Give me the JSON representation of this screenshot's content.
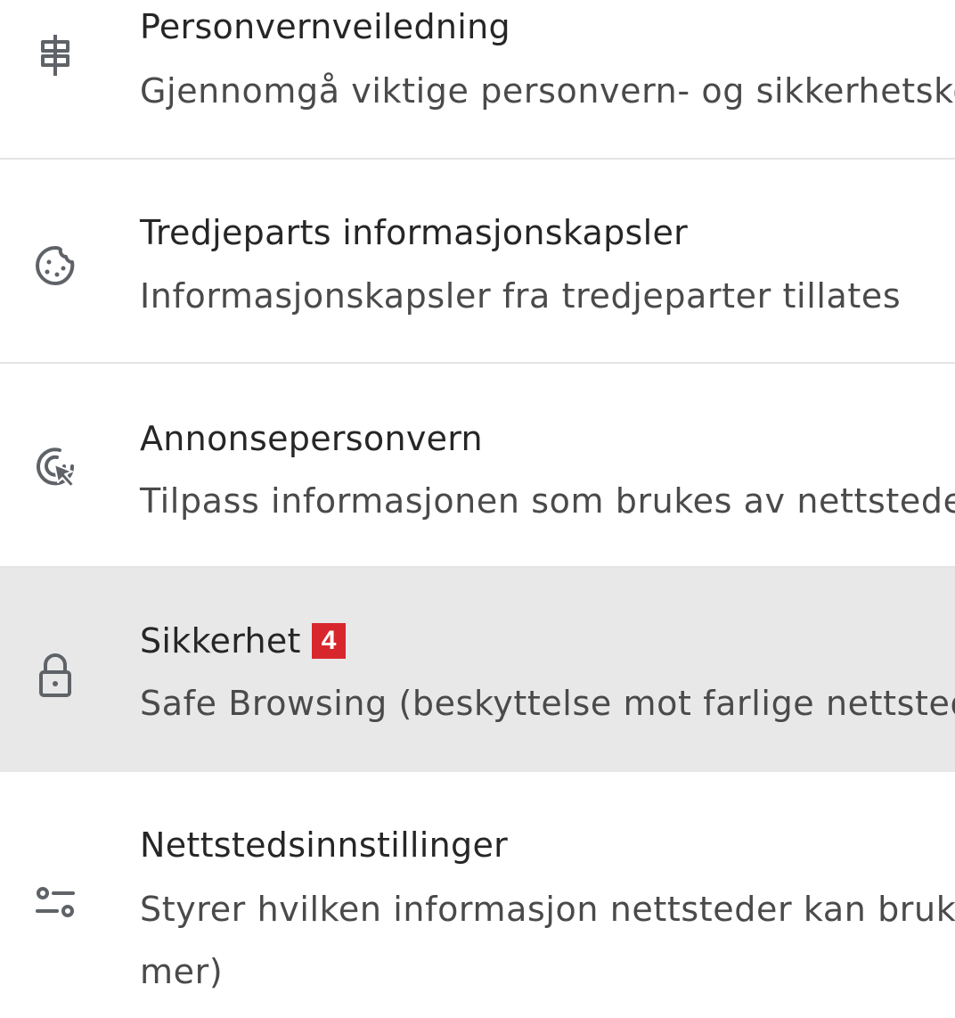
{
  "items": [
    {
      "title": "Personvernveiledning",
      "subtitle": "Gjennomgå viktige personvern- og sikkerhetskontroller",
      "icon": "signpost-icon"
    },
    {
      "title": "Tredjeparts informasjonskapsler",
      "subtitle": "Informasjonskapsler fra tredjeparter tillates",
      "icon": "cookie-icon"
    },
    {
      "title": "Annonsepersonvern",
      "subtitle": "Tilpass informasjonen som brukes av nettsteder",
      "icon": "ad-target-cursor-icon"
    },
    {
      "title": "Sikkerhet",
      "badge": "4",
      "subtitle": "Safe Browsing (beskyttelse mot farlige nettsteder)",
      "icon": "lock-icon",
      "active": true
    },
    {
      "title": "Nettstedsinnstillinger",
      "subtitle": "Styrer hvilken informasjon nettsteder kan bruke og vise (posisjon, kamera, forgrunnsvinduer med",
      "subtitle_line2": "mer)",
      "icon": "sliders-icon"
    }
  ],
  "colors": {
    "active_row_bg": "#e8e8e8",
    "badge_bg": "#d7272d",
    "icon": "#5f6368"
  }
}
